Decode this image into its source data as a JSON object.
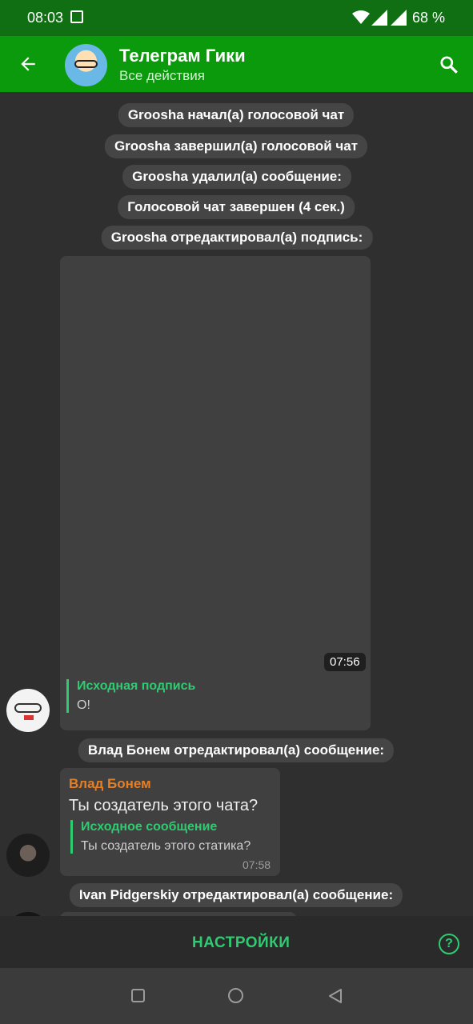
{
  "status": {
    "time": "08:03",
    "battery": "68 %"
  },
  "header": {
    "title": "Телеграм Гики",
    "subtitle": "Все действия"
  },
  "events": [
    "Groosha начал(а) голосовой чат",
    "Groosha завершил(а) голосовой чат",
    "Groosha удалил(а) сообщение:",
    "Голосовой чат завершен (4 сек.)",
    "Groosha отредактировал(а) подпись:",
    "Влад Бонем отредактировал(а) сообщение:",
    "Ivan Pidgerskiy отредактировал(а) сообщение:"
  ],
  "media_message": {
    "time": "07:56",
    "quote_title": "Исходная подпись",
    "quote_text": "О!"
  },
  "text_message": {
    "sender": "Влад Бонем",
    "text": "Ты создатель этого чата?",
    "quote_title": "Исходное сообщение",
    "quote_text": "Ты создатель этого статика?",
    "time": "07:58"
  },
  "bottom": {
    "settings_label": "НАСТРОЙКИ",
    "help_label": "?"
  },
  "colors": {
    "status_bar": "#0f6f12",
    "app_bar": "#0b9a0b",
    "accent": "#2ecc71",
    "sender_name": "#e67e22"
  }
}
